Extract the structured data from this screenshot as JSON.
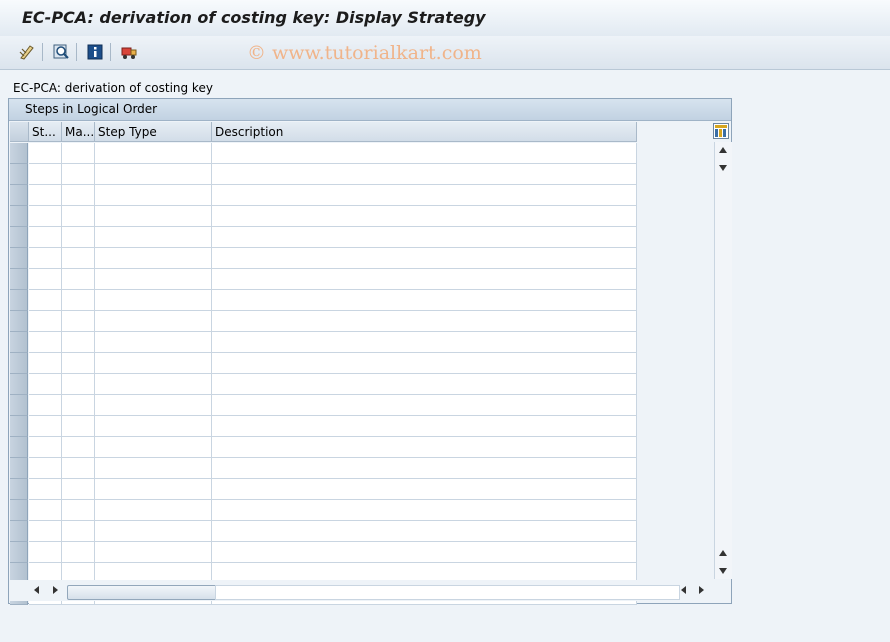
{
  "window": {
    "title": "EC-PCA: derivation of costing key: Display Strategy"
  },
  "watermark": "© www.tutorialkart.com",
  "toolbar": {
    "buttons": [
      {
        "icon": "display-change-icon"
      },
      {
        "icon": "find-icon"
      },
      {
        "icon": "info-icon"
      },
      {
        "icon": "transport-icon"
      }
    ]
  },
  "section": {
    "label": "EC-PCA: derivation of costing key"
  },
  "table": {
    "title": "Steps in Logical Order",
    "columns": [
      "St...",
      "Ma...",
      "Step Type",
      "Description"
    ],
    "rows": [
      [
        "",
        "",
        "",
        ""
      ],
      [
        "",
        "",
        "",
        ""
      ],
      [
        "",
        "",
        "",
        ""
      ],
      [
        "",
        "",
        "",
        ""
      ],
      [
        "",
        "",
        "",
        ""
      ],
      [
        "",
        "",
        "",
        ""
      ],
      [
        "",
        "",
        "",
        ""
      ],
      [
        "",
        "",
        "",
        ""
      ],
      [
        "",
        "",
        "",
        ""
      ],
      [
        "",
        "",
        "",
        ""
      ],
      [
        "",
        "",
        "",
        ""
      ],
      [
        "",
        "",
        "",
        ""
      ],
      [
        "",
        "",
        "",
        ""
      ],
      [
        "",
        "",
        "",
        ""
      ],
      [
        "",
        "",
        "",
        ""
      ],
      [
        "",
        "",
        "",
        ""
      ],
      [
        "",
        "",
        "",
        ""
      ],
      [
        "",
        "",
        "",
        ""
      ],
      [
        "",
        "",
        "",
        ""
      ],
      [
        "",
        "",
        "",
        ""
      ],
      [
        "",
        "",
        "",
        ""
      ],
      [
        "",
        "",
        "",
        ""
      ]
    ]
  },
  "colors": {
    "accent": "#1c4e8a",
    "watermark": "#f0b48a"
  }
}
